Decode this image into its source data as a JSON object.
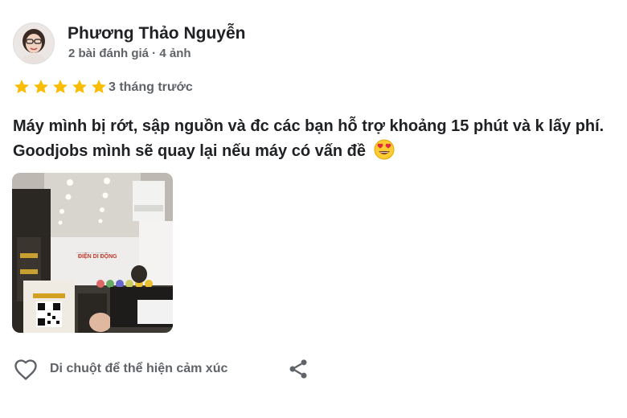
{
  "reviewer": {
    "name": "Phương Thảo Nguyễn",
    "meta": "2 bài đánh giá · 4 ảnh",
    "avatar_icon": "person-avatar-icon"
  },
  "rating": {
    "stars": 5,
    "max": 5,
    "star_color": "#fbbc04",
    "time": "3 tháng trước"
  },
  "review": {
    "text": "Máy mình bị rớt, sập nguồn và đc các bạn hỗ trợ khoảng 15 phút và k lấy phí. Goodjobs mình sẽ quay lại nếu máy có vấn đề",
    "emoji": "heart-eyes-emoji-icon"
  },
  "photo": {
    "shop_sign": "ĐIỆN DI ĐỘNG"
  },
  "actions": {
    "react_label": "Di chuột để thể hiện cảm xúc",
    "heart_icon": "heart-icon",
    "share_icon": "share-icon"
  }
}
